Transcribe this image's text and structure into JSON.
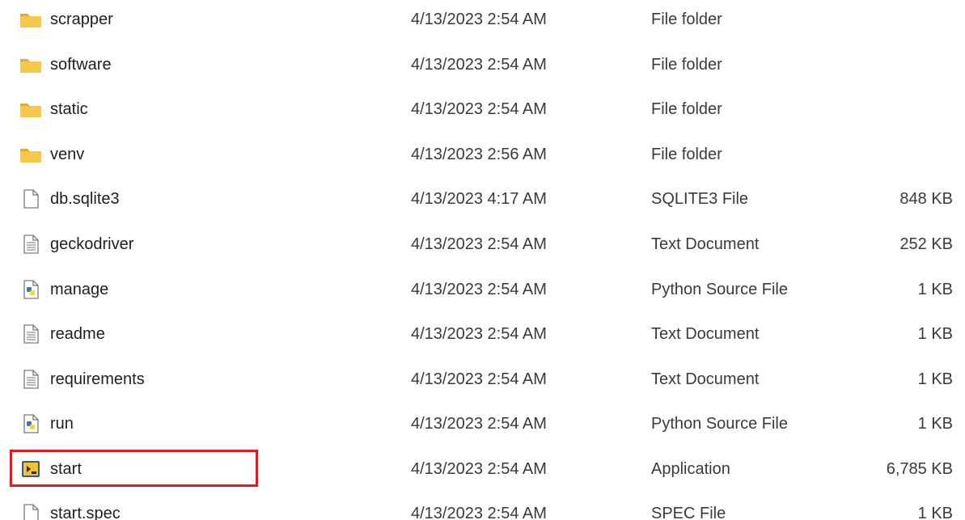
{
  "files": [
    {
      "name": "scrapper",
      "date": "4/13/2023 2:54 AM",
      "type": "File folder",
      "size": "",
      "icon": "folder-icon"
    },
    {
      "name": "software",
      "date": "4/13/2023 2:54 AM",
      "type": "File folder",
      "size": "",
      "icon": "folder-icon"
    },
    {
      "name": "static",
      "date": "4/13/2023 2:54 AM",
      "type": "File folder",
      "size": "",
      "icon": "folder-icon"
    },
    {
      "name": "venv",
      "date": "4/13/2023 2:56 AM",
      "type": "File folder",
      "size": "",
      "icon": "folder-icon"
    },
    {
      "name": "db.sqlite3",
      "date": "4/13/2023 4:17 AM",
      "type": "SQLITE3 File",
      "size": "848 KB",
      "icon": "blank-file-icon"
    },
    {
      "name": "geckodriver",
      "date": "4/13/2023 2:54 AM",
      "type": "Text Document",
      "size": "252 KB",
      "icon": "text-document-icon"
    },
    {
      "name": "manage",
      "date": "4/13/2023 2:54 AM",
      "type": "Python Source File",
      "size": "1 KB",
      "icon": "python-file-icon"
    },
    {
      "name": "readme",
      "date": "4/13/2023 2:54 AM",
      "type": "Text Document",
      "size": "1 KB",
      "icon": "text-document-icon"
    },
    {
      "name": "requirements",
      "date": "4/13/2023 2:54 AM",
      "type": "Text Document",
      "size": "1 KB",
      "icon": "text-document-icon"
    },
    {
      "name": "run",
      "date": "4/13/2023 2:54 AM",
      "type": "Python Source File",
      "size": "1 KB",
      "icon": "python-file-icon"
    },
    {
      "name": "start",
      "date": "4/13/2023 2:54 AM",
      "type": "Application",
      "size": "6,785 KB",
      "icon": "application-icon"
    },
    {
      "name": "start.spec",
      "date": "4/13/2023 2:54 AM",
      "type": "SPEC File",
      "size": "1 KB",
      "icon": "blank-file-icon"
    }
  ],
  "colors": {
    "folder": "#f4c542",
    "highlight": "#e11b1b",
    "python_blue": "#3c78aa",
    "python_yellow": "#ffd43b"
  }
}
